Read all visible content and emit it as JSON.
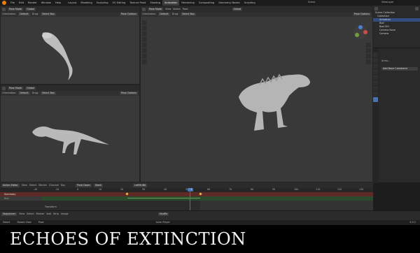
{
  "menu": [
    "File",
    "Edit",
    "Render",
    "Window",
    "Help"
  ],
  "workspaces": [
    "Layout",
    "Modeling",
    "Sculpting",
    "UV Editing",
    "Texture Paint",
    "Shading",
    "Animation",
    "Rendering",
    "Compositing",
    "Geometry Nodes",
    "Scripting"
  ],
  "active_workspace": "Animation",
  "scene": {
    "label": "Scene"
  },
  "view_layer": {
    "label": "ViewLayer"
  },
  "viewport": {
    "mode": "Pose Mode",
    "orientation_label": "Orientation:",
    "orientation_value": "Default",
    "drag_label": "Drag:",
    "drag_value": "Select Box",
    "pose_options": "Pose Options",
    "transform": "Global",
    "menu": [
      "View",
      "Select",
      "Pose"
    ]
  },
  "outliner": {
    "title": "Scene Collection",
    "items": [
      "Collection",
      "Armature",
      "Bod",
      "Bod.001",
      "Camera Bone",
      "Camera"
    ]
  },
  "properties": {
    "header": "Arma...",
    "add_constraint": "Add Bone Constraint"
  },
  "action_editor": {
    "mode": "Action Editor",
    "menu": [
      "View",
      "Select",
      "Marker",
      "Channel",
      "Key"
    ],
    "push_down": "Push Down",
    "stash": "Stash",
    "action_name": "LeftHUBA",
    "summary": "Summary",
    "channel": "Bod",
    "frames": [
      "-40",
      "-20",
      "0",
      "10",
      "20",
      "30",
      "40",
      "50",
      "60",
      "70",
      "80",
      "90",
      "100",
      "110",
      "120",
      "130"
    ],
    "current_frame": "33",
    "transform_label": "Transform"
  },
  "sequencer": {
    "mode": "Sequencer",
    "menu": [
      "View",
      "Select",
      "Marker",
      "Add",
      "Strip",
      "Image"
    ],
    "shuffle": "Shuffle"
  },
  "status": {
    "left": [
      "Select",
      "Rotate View",
      "Pose"
    ],
    "center": "Anim Player",
    "right": "4.0.2"
  },
  "overlay_title": "ECHOES OF EXTINCTION",
  "colors": {
    "accent": "#e87d0d",
    "keyframe": "#e8b84a",
    "playhead": "#4772b3",
    "green": "#5ea25e"
  }
}
